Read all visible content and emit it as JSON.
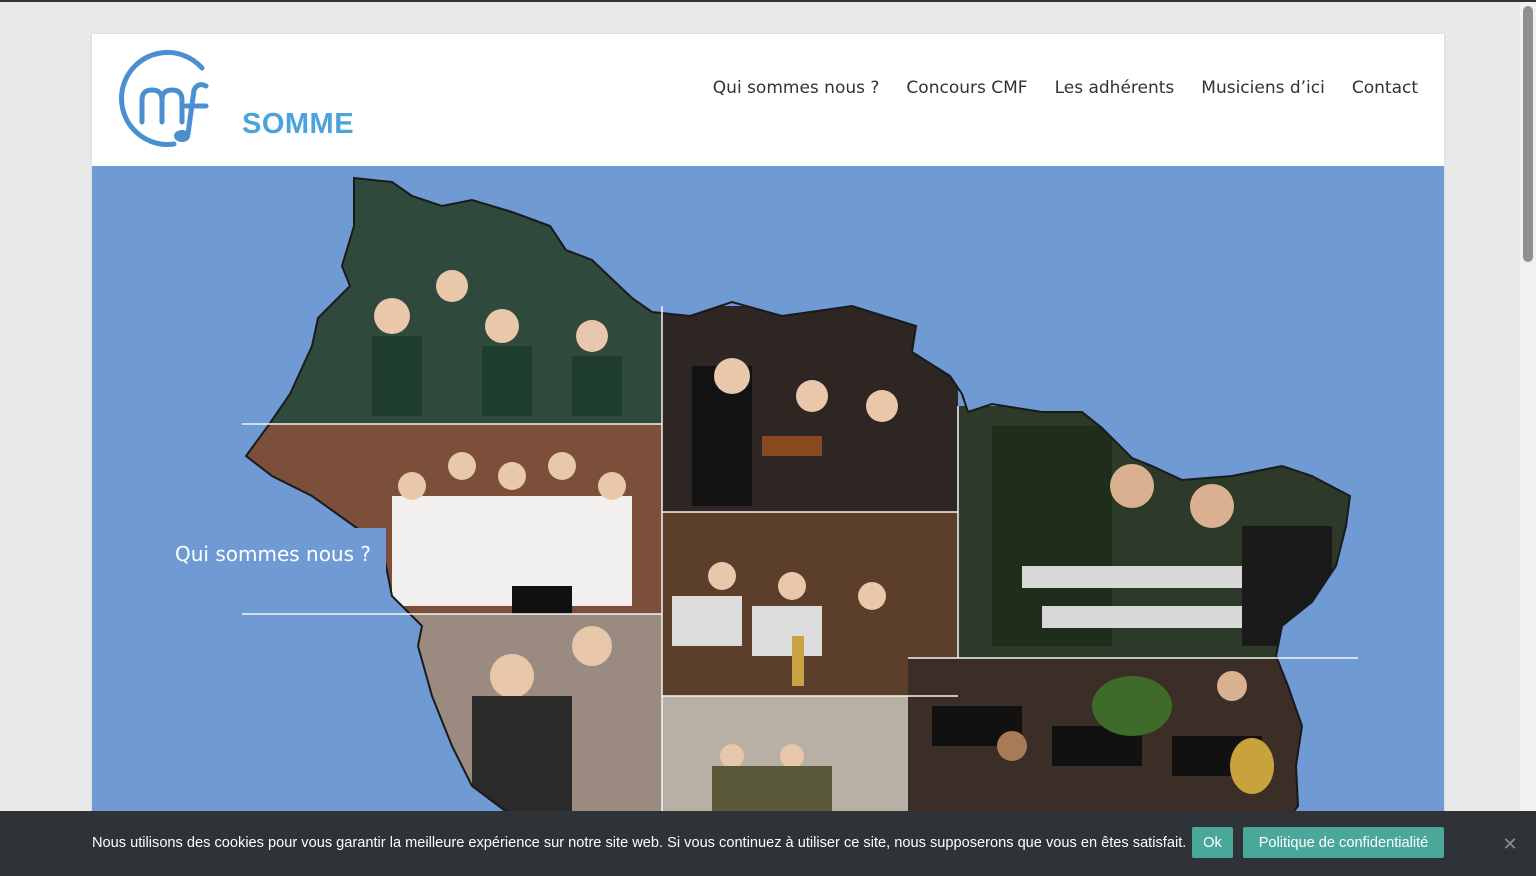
{
  "site": {
    "logo_text": "SOMME",
    "brand_color": "#4aa3dc"
  },
  "nav": {
    "items": [
      {
        "label": "Qui sommes nous ?"
      },
      {
        "label": "Concours CMF"
      },
      {
        "label": "Les adhérents"
      },
      {
        "label": "Musiciens d’ici"
      },
      {
        "label": "Contact"
      }
    ]
  },
  "hero": {
    "button_label": "Qui sommes nous ?",
    "background_color": "#6f9ad4"
  },
  "cookie": {
    "message": "Nous utilisons des cookies pour vous garantir la meilleure expérience sur notre site web. Si vous continuez à utiliser ce site, nous supposerons que vous en êtes satisfait.",
    "ok_label": "Ok",
    "policy_label": "Politique de confidentialité",
    "close_icon": "close-icon",
    "button_color": "#4aa89a"
  }
}
